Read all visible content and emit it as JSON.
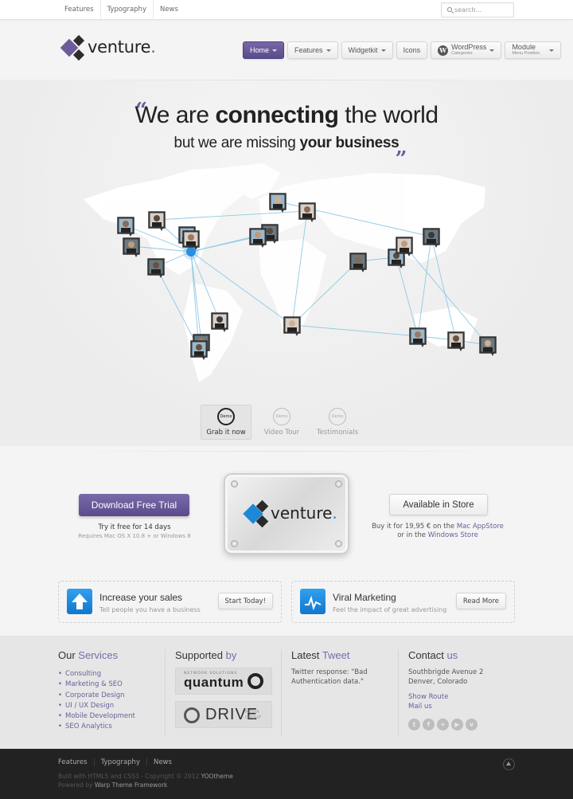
{
  "toolbar": {
    "menu": [
      "Features",
      "Typography",
      "News"
    ],
    "search_placeholder": "search..."
  },
  "logo": {
    "text": "venture",
    "dot": "."
  },
  "nav": {
    "items": [
      {
        "label": "Home",
        "active": true,
        "dropdown": true
      },
      {
        "label": "Features",
        "dropdown": true
      },
      {
        "label": "Widgetkit",
        "dropdown": true
      },
      {
        "label": "Icons",
        "dropdown": false
      },
      {
        "label": "WordPress",
        "sub": "Categories",
        "icon": "wordpress-icon",
        "dropdown": true
      },
      {
        "label": "Module",
        "sub": "Menu Position",
        "dropdown": true
      }
    ]
  },
  "hero": {
    "line1_pre": "We are ",
    "line1_bold": "connecting",
    "line1_post": " the world",
    "line2_pre": "but we are missing ",
    "line2_bold": "your business",
    "quote_open": "“",
    "quote_close": "„"
  },
  "map": {
    "hub_color": "#2a8fe0",
    "line_color": "#8ecae6"
  },
  "tabs": [
    {
      "label": "Grab it now",
      "badge": "Demo",
      "active": true
    },
    {
      "label": "Video Tour",
      "badge": "Demo",
      "active": false
    },
    {
      "label": "Testimonials",
      "badge": "Demo",
      "active": false
    }
  ],
  "cta": {
    "download_label": "Download Free Trial",
    "trial_text": "Try it free for 14 days",
    "requirements": "Requires Mac OS X 10.8 + or Windows 8",
    "plate_logo": "venture",
    "plate_dot": ".",
    "store_label": "Available in Store",
    "store_text_pre": "Buy it for 19,95 € on the ",
    "store_link1": "Mac AppStore",
    "store_text_mid": "or in the ",
    "store_link2": "Windows Store"
  },
  "promo": [
    {
      "title": "Increase your sales",
      "subtitle": "Tell people you have a business",
      "button": "Start Today!",
      "icon": "arrow-up-icon"
    },
    {
      "title": "Viral Marketing",
      "subtitle": "Feel the impact of great advertising",
      "button": "Read More",
      "icon": "pulse-icon"
    }
  ],
  "bottom": {
    "services": {
      "title_a": "Our",
      "title_b": "Services",
      "items": [
        "Consulting",
        "Marketing & SEO",
        "Corporate Design",
        "UI / UX Design",
        "Mobile Development",
        "SEO Analytics"
      ]
    },
    "supported": {
      "title_a": "Supported",
      "title_b": "by",
      "quantum_top": "NETWORK SOLUTIONS",
      "quantum": "quantum",
      "drive": "DRIVE",
      "drive_sub1": "MEDIA",
      "drive_sub2": "GROUP"
    },
    "tweet": {
      "title_a": "Latest",
      "title_b": "Tweet",
      "text": "Twitter response: \"Bad Authentication data.\""
    },
    "contact": {
      "title_a": "Contact",
      "title_b": "us",
      "address1": "Southbrigde Avenue 2",
      "address2": "Denver, Colorado",
      "link1": "Show Route",
      "link2": "Mail us",
      "social": [
        "t",
        "f",
        "+",
        "▶",
        "v"
      ]
    }
  },
  "footer": {
    "menu": [
      "Features",
      "Typography",
      "News"
    ],
    "copy1": "Built with HTML5 and CSS3 - Copyright © 2012 ",
    "copy1_b": "YOOtheme",
    "copy2": "Powered by ",
    "copy2_b": "Warp Theme Framework"
  }
}
